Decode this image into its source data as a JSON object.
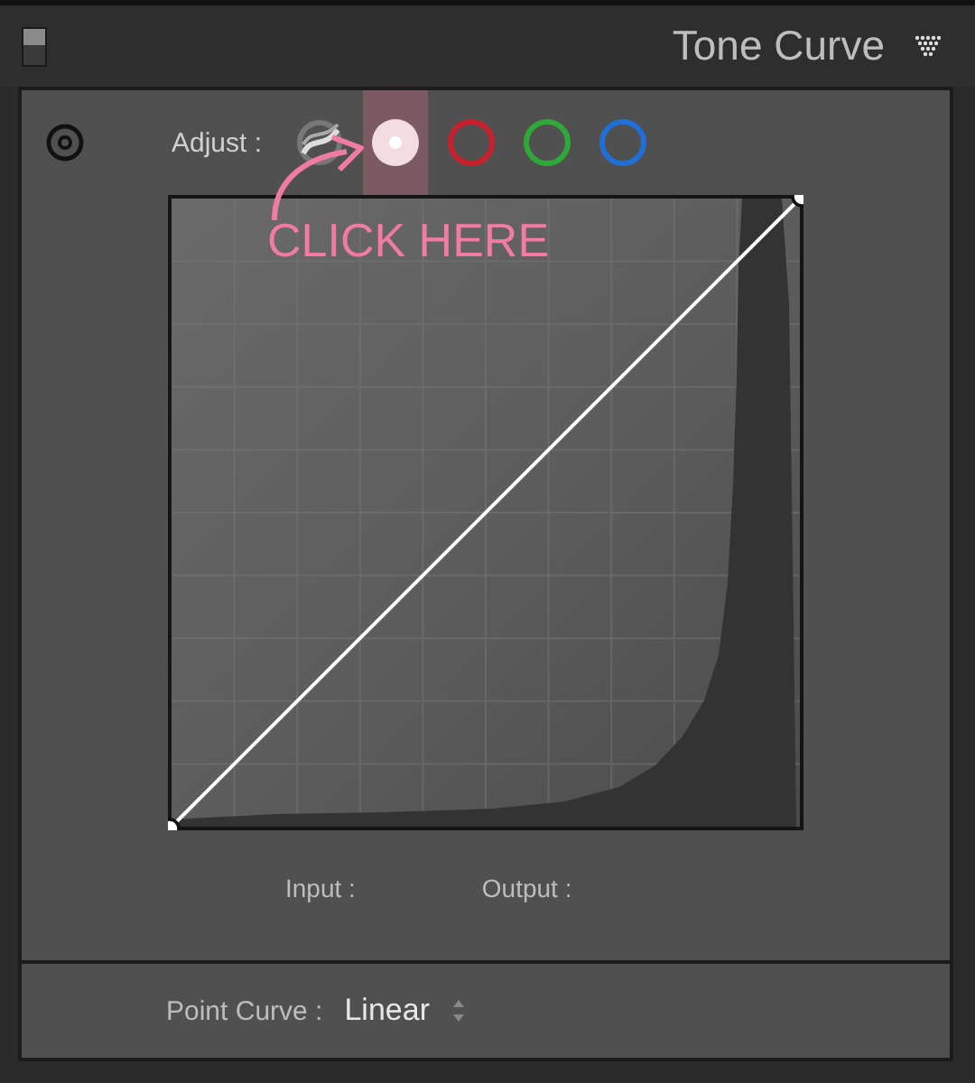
{
  "header": {
    "title": "Tone Curve"
  },
  "adjust": {
    "label": "Adjust :",
    "channels": [
      {
        "kind": "parametric",
        "selected": false
      },
      {
        "kind": "channel",
        "color": "#f2dde3",
        "selected": true
      },
      {
        "kind": "channel",
        "color": "#c8202c",
        "selected": false
      },
      {
        "kind": "channel",
        "color": "#2fa83a",
        "selected": false
      },
      {
        "kind": "channel",
        "color": "#1f6fd6",
        "selected": false
      }
    ]
  },
  "annotation": {
    "text": "CLICK HERE"
  },
  "readout": {
    "input_label": "Input :",
    "output_label": "Output :"
  },
  "point_curve": {
    "label": "Point Curve :",
    "value": "Linear"
  }
}
